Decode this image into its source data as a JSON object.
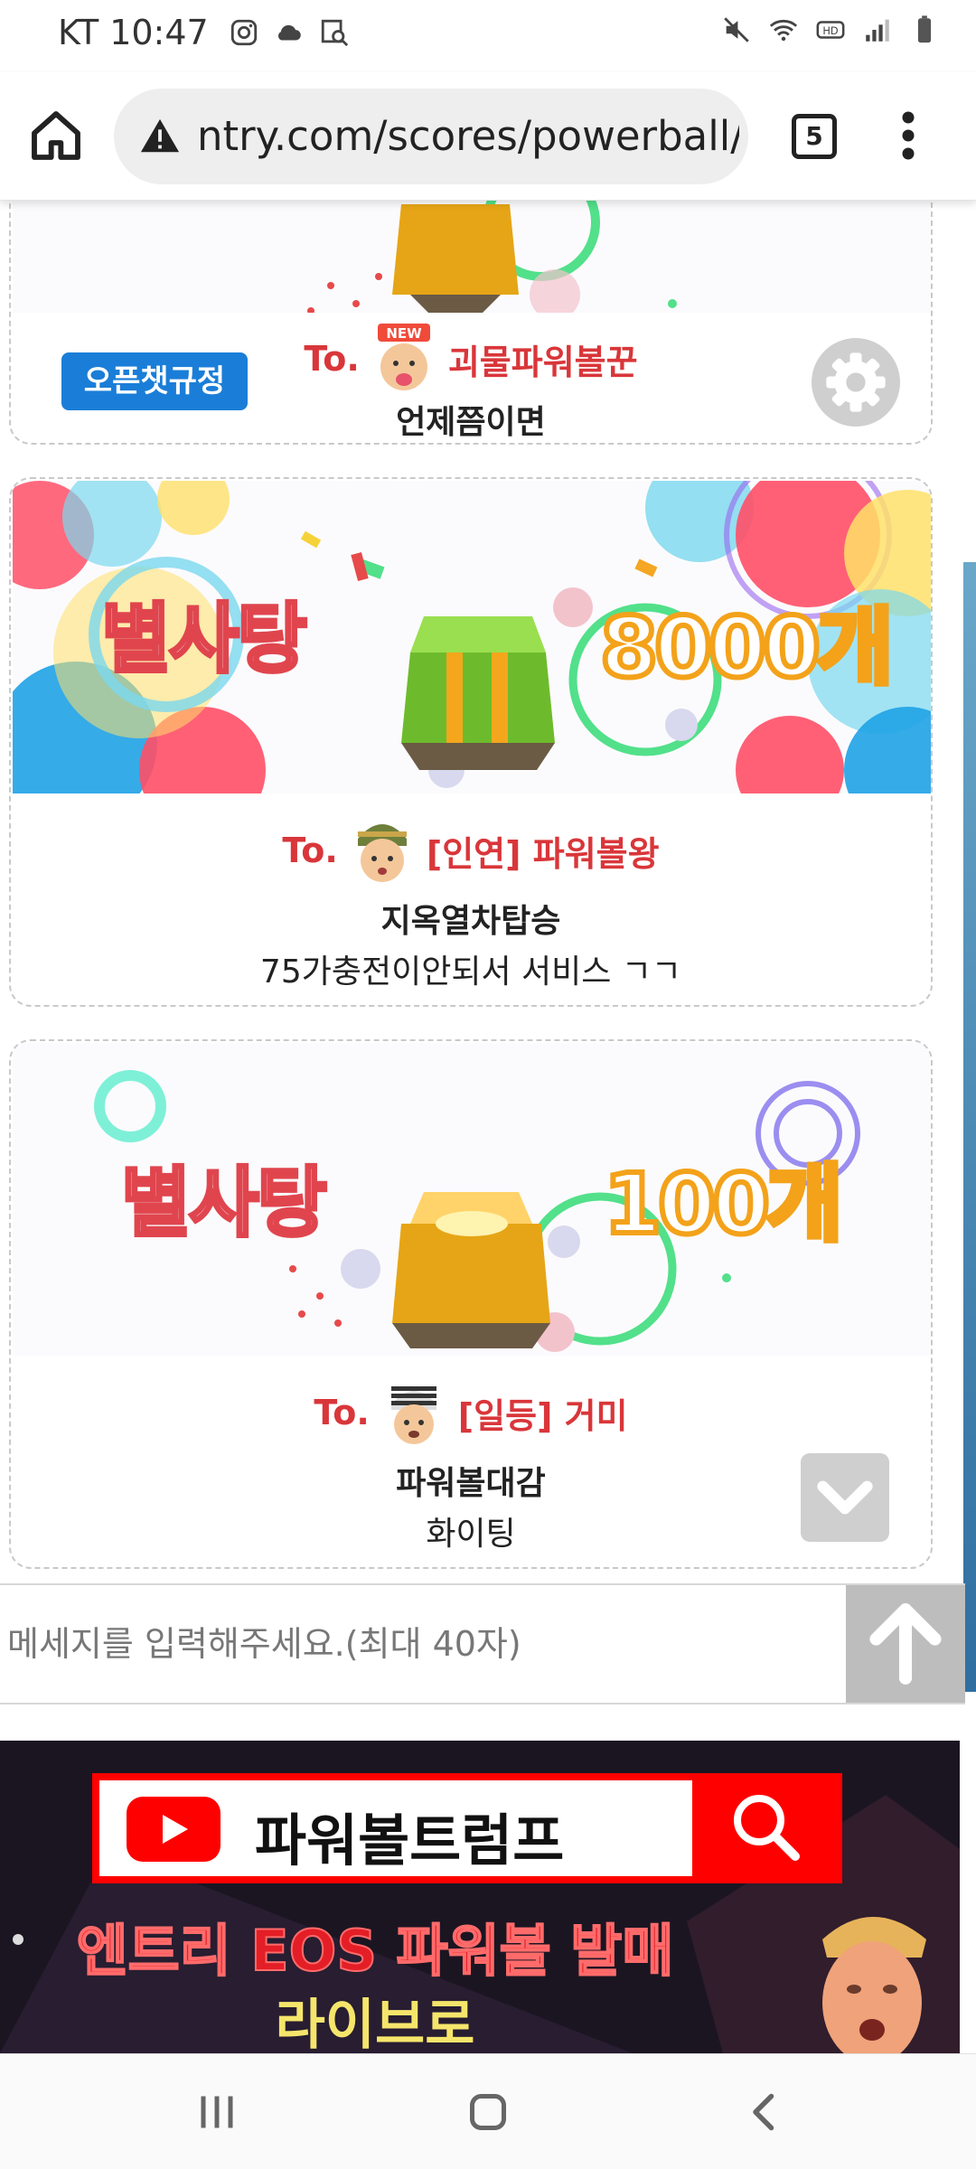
{
  "status_bar": {
    "carrier": "KT",
    "time": "10:47",
    "left_icons": [
      "instagram-icon",
      "cloud-icon",
      "gallery-search-icon"
    ],
    "right_icons": [
      "mute-icon",
      "wifi-icon",
      "hd-voice-icon",
      "signal-icon",
      "battery-icon"
    ]
  },
  "browser": {
    "url": "ntry.com/scores/powerball/r",
    "tab_count": "5"
  },
  "chat": {
    "openchat_rules_label": "오픈챗규정",
    "messages": [
      {
        "to_prefix": "To.",
        "recipient": "괴물파워볼꾼",
        "badge": "NEW",
        "title": "언제쯤이면",
        "body": ""
      },
      {
        "banner_title": "별사탕",
        "count": "8000개",
        "to_prefix": "To.",
        "recipient": "[인연] 파워볼왕",
        "title": "지옥열차탑승",
        "body": "75가충전이안되서 서비스 ㄱㄱ"
      },
      {
        "banner_title": "별사탕",
        "count": "100개",
        "to_prefix": "To.",
        "recipient": "[일등] 거미",
        "title": "파워볼대감",
        "body": "화이팅"
      }
    ],
    "input_placeholder": "메세지를 입력해주세요.(최대 40자)"
  },
  "ad": {
    "search_query": "파워볼트럼프",
    "line1": "엔트리 EOS 파워볼 발매",
    "line2": "라이브로"
  },
  "colors": {
    "accent_red": "#d9363a",
    "openchat_blue": "#1a7ed8",
    "count_orange": "#f3a21a"
  }
}
